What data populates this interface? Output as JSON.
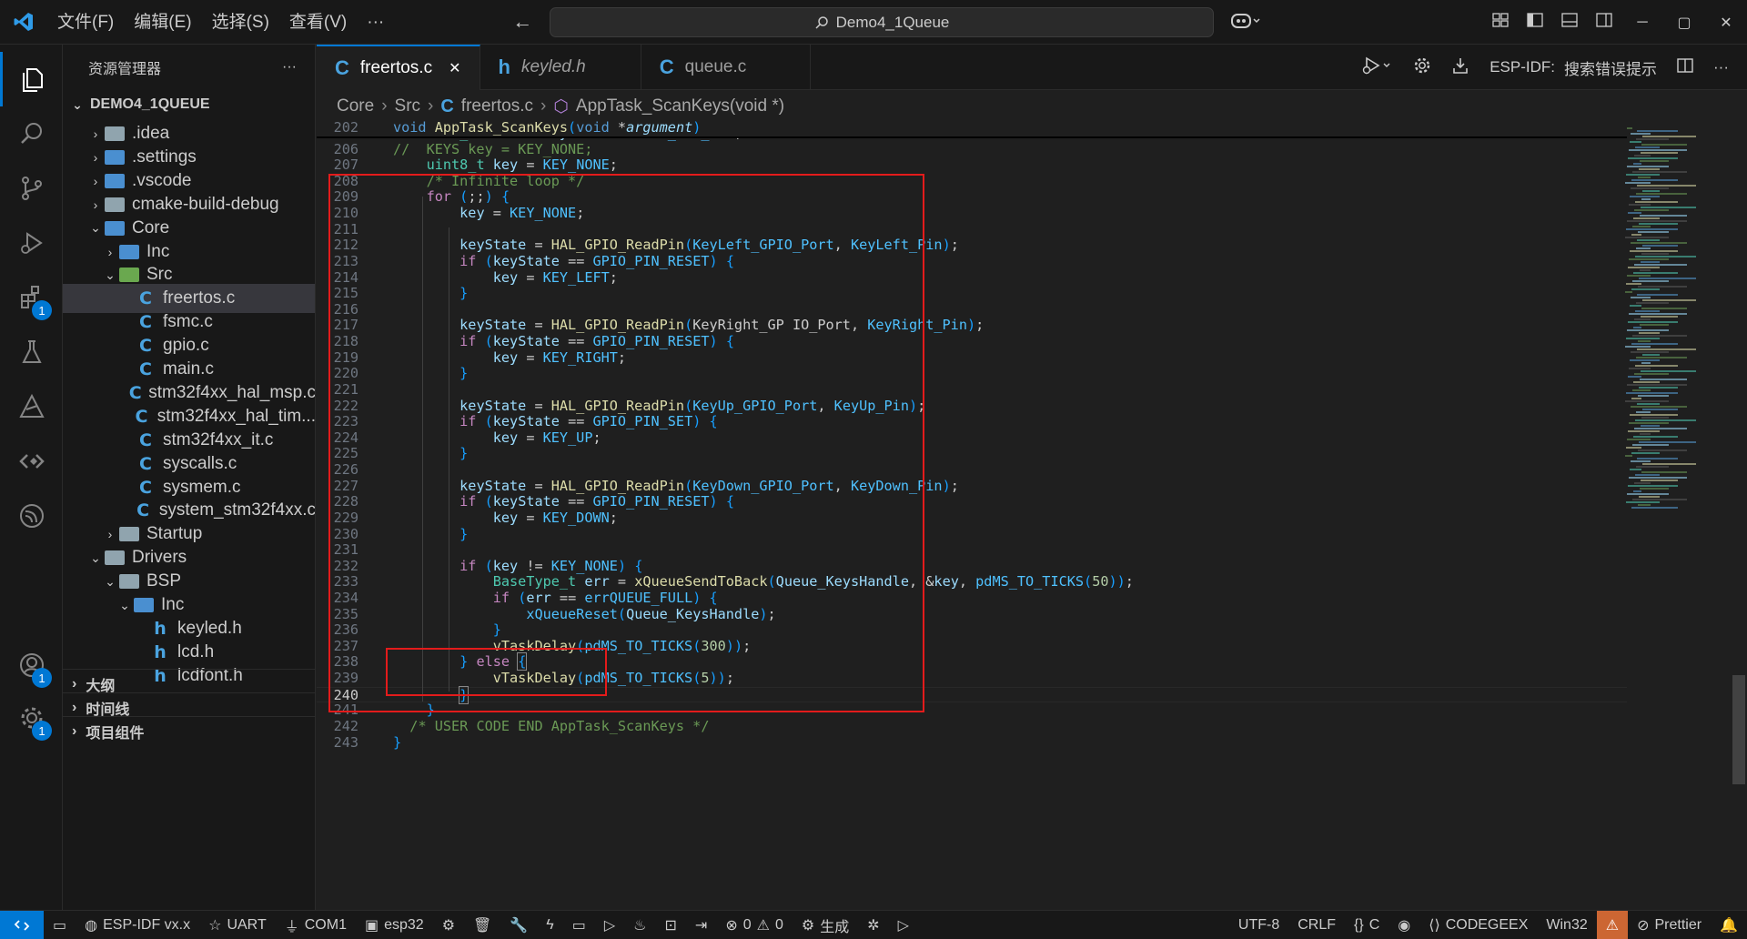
{
  "titlebar": {
    "menu": [
      "文件(F)",
      "编辑(E)",
      "选择(S)",
      "查看(V)",
      "···"
    ],
    "back": "←",
    "forward": "→",
    "search_text": "Demo4_1Queue"
  },
  "sidebar": {
    "title": "资源管理器",
    "more": "···",
    "root": "DEMO4_1QUEUE",
    "tree": [
      {
        "label": ".idea",
        "depth": 1,
        "chev": "›",
        "kind": "folder"
      },
      {
        "label": ".settings",
        "depth": 1,
        "chev": "›",
        "kind": "folder-blue"
      },
      {
        "label": ".vscode",
        "depth": 1,
        "chev": "›",
        "kind": "folder-blue"
      },
      {
        "label": "cmake-build-debug",
        "depth": 1,
        "chev": "›",
        "kind": "folder"
      },
      {
        "label": "Core",
        "depth": 1,
        "chev": "⌄",
        "kind": "folder-blue"
      },
      {
        "label": "Inc",
        "depth": 2,
        "chev": "›",
        "kind": "folder-blue"
      },
      {
        "label": "Src",
        "depth": 2,
        "chev": "⌄",
        "kind": "folder-green"
      },
      {
        "label": "freertos.c",
        "depth": 3,
        "chev": "",
        "kind": "c",
        "selected": true
      },
      {
        "label": "fsmc.c",
        "depth": 3,
        "chev": "",
        "kind": "c"
      },
      {
        "label": "gpio.c",
        "depth": 3,
        "chev": "",
        "kind": "c"
      },
      {
        "label": "main.c",
        "depth": 3,
        "chev": "",
        "kind": "c"
      },
      {
        "label": "stm32f4xx_hal_msp.c",
        "depth": 3,
        "chev": "",
        "kind": "c"
      },
      {
        "label": "stm32f4xx_hal_tim...",
        "depth": 3,
        "chev": "",
        "kind": "c"
      },
      {
        "label": "stm32f4xx_it.c",
        "depth": 3,
        "chev": "",
        "kind": "c"
      },
      {
        "label": "syscalls.c",
        "depth": 3,
        "chev": "",
        "kind": "c"
      },
      {
        "label": "sysmem.c",
        "depth": 3,
        "chev": "",
        "kind": "c"
      },
      {
        "label": "system_stm32f4xx.c",
        "depth": 3,
        "chev": "",
        "kind": "c"
      },
      {
        "label": "Startup",
        "depth": 2,
        "chev": "›",
        "kind": "folder"
      },
      {
        "label": "Drivers",
        "depth": 1,
        "chev": "⌄",
        "kind": "folder"
      },
      {
        "label": "BSP",
        "depth": 2,
        "chev": "⌄",
        "kind": "folder"
      },
      {
        "label": "Inc",
        "depth": 3,
        "chev": "⌄",
        "kind": "folder-blue"
      },
      {
        "label": "keyled.h",
        "depth": 4,
        "chev": "",
        "kind": "h"
      },
      {
        "label": "lcd.h",
        "depth": 4,
        "chev": "",
        "kind": "h"
      },
      {
        "label": "lcdfont.h",
        "depth": 4,
        "chev": "",
        "kind": "h"
      }
    ],
    "sections": [
      "大纲",
      "时间线",
      "项目组件"
    ]
  },
  "tabs": [
    {
      "label": "freertos.c",
      "icon": "C",
      "active": true,
      "close": "✕"
    },
    {
      "label": "keyled.h",
      "icon": "h",
      "active": false,
      "italic": true
    },
    {
      "label": "queue.c",
      "icon": "C",
      "active": false
    }
  ],
  "tab_actions": {
    "espidf": "ESP-IDF:",
    "search_errors": "搜索错误提示",
    "more": "···"
  },
  "breadcrumb": [
    "Core",
    "Src",
    "freertos.c",
    "AppTask_ScanKeys(void *)"
  ],
  "editor": {
    "sticky_line": 202,
    "first_line": 205,
    "current_line": 240
  },
  "status": {
    "espidf": "ESP-IDF vx.x",
    "uart": "UART",
    "com": "COM1",
    "chip": "esp32",
    "build": "生成",
    "errors": "0",
    "warnings": "0",
    "encoding": "UTF-8",
    "eol": "CRLF",
    "lang": "C",
    "codegeex": "CODEGEEX",
    "platform": "Win32",
    "prettier": "Prettier"
  },
  "colors": {
    "accent": "#0078d4",
    "highlight_box": "#e31b1b"
  }
}
